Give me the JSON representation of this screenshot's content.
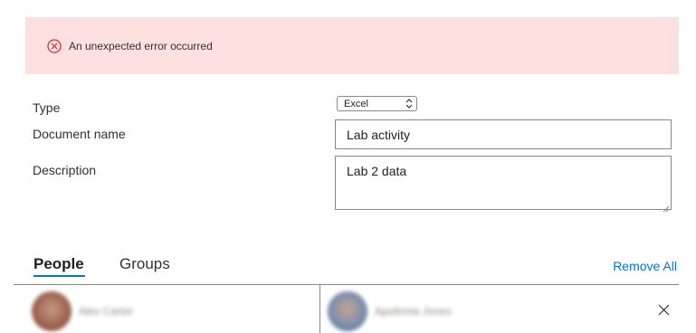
{
  "error_banner": {
    "message": "An unexpected error occurred",
    "icon": "error-circle-icon",
    "background_color": "#fde0df",
    "icon_color": "#d13438"
  },
  "form": {
    "type_label": "Type",
    "type_value": "Excel",
    "document_name_label": "Document name",
    "document_name_value": "Lab activity",
    "description_label": "Description",
    "description_value": "Lab 2 data"
  },
  "tabs": [
    {
      "label": "People",
      "selected": true
    },
    {
      "label": "Groups",
      "selected": false
    }
  ],
  "actions": {
    "remove_all_label": "Remove All"
  },
  "people": [
    {
      "name": "Alex Carter"
    },
    {
      "name": "Apollonia Jones"
    }
  ],
  "colors": {
    "accent": "#0078d4",
    "border": "#8a8886",
    "text": "#323130"
  }
}
